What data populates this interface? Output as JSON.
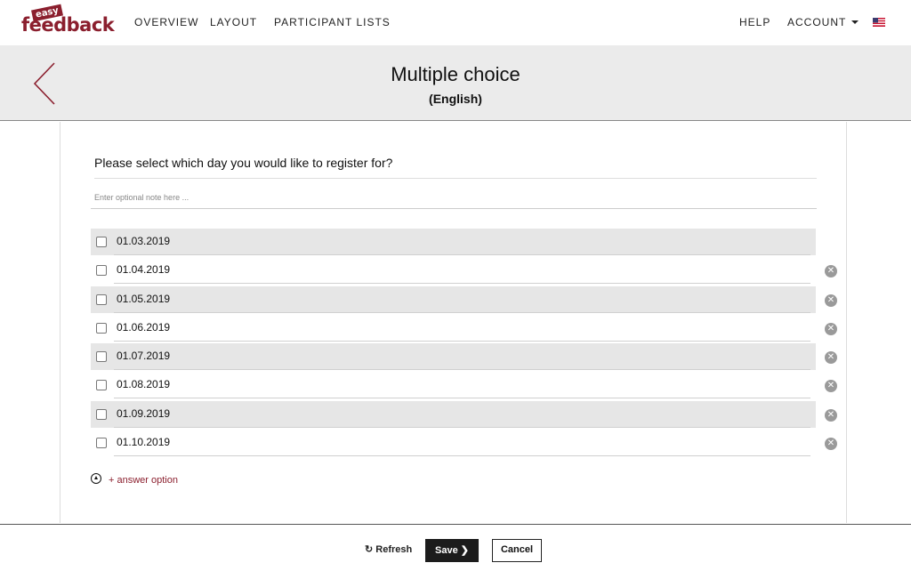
{
  "brand": {
    "small": "easy",
    "main": "feedback",
    "color": "#8b1f2e"
  },
  "nav": {
    "overview": "OVERVIEW",
    "layout": "LAYOUT",
    "participant_lists": "PARTICIPANT LISTS",
    "help": "HELP",
    "account": "ACCOUNT",
    "language_icon": "us-flag-icon"
  },
  "header": {
    "title": "Multiple choice",
    "subtitle": "(English)",
    "back_icon": "chevron-left-icon"
  },
  "question": {
    "text": "Please select which day you would like to register for?",
    "note_placeholder": "Enter optional note here ..."
  },
  "options": [
    {
      "label": "01.03.2019",
      "removable": false
    },
    {
      "label": "01.04.2019",
      "removable": true
    },
    {
      "label": "01.05.2019",
      "removable": true
    },
    {
      "label": "01.06.2019",
      "removable": true
    },
    {
      "label": "01.07.2019",
      "removable": true
    },
    {
      "label": "01.08.2019",
      "removable": true
    },
    {
      "label": "01.09.2019",
      "removable": true
    },
    {
      "label": "01.10.2019",
      "removable": true
    }
  ],
  "add_option_label": "+ answer option",
  "footer": {
    "refresh": "Refresh",
    "save": "Save",
    "cancel": "Cancel"
  }
}
